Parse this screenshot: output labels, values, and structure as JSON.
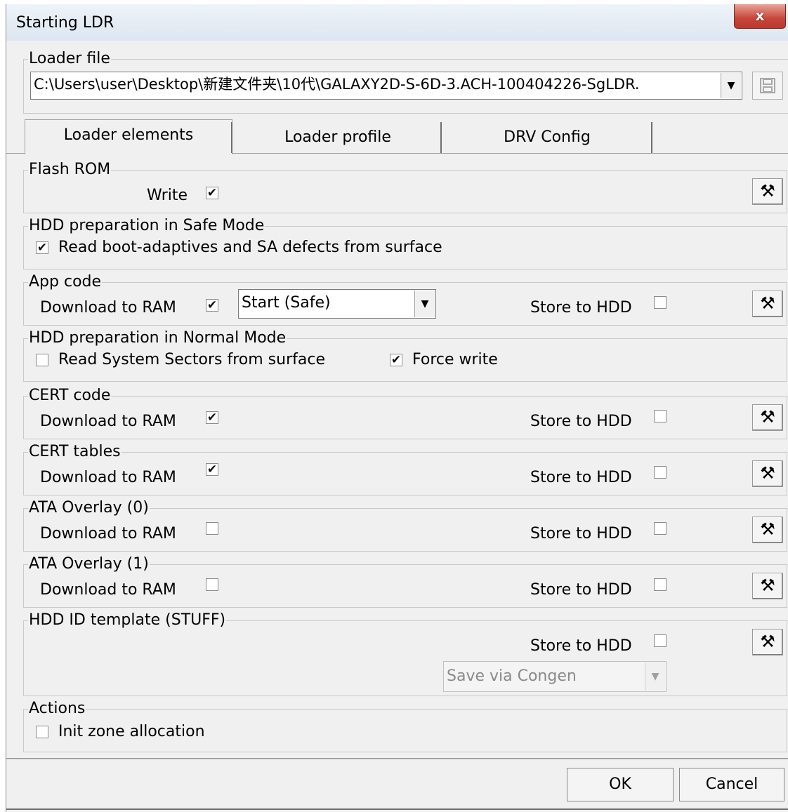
{
  "window": {
    "title": "Starting LDR",
    "close_label": "x"
  },
  "loader_file": {
    "legend": "Loader file",
    "path": "C:\\Users\\user\\Desktop\\新建文件夹\\10代\\GALAXY2D-S-6D-3.ACH-100404226-SgLDR."
  },
  "tabs": [
    {
      "label": "Loader elements",
      "active": true
    },
    {
      "label": "Loader profile",
      "active": false
    },
    {
      "label": "DRV Config",
      "active": false
    }
  ],
  "flash_rom": {
    "legend": "Flash ROM",
    "write_label": "Write",
    "write_checked": true
  },
  "hdd_safe": {
    "legend": "HDD preparation in Safe Mode",
    "read_label": "Read boot-adaptives and SA defects from surface",
    "read_checked": true
  },
  "app_code": {
    "legend": "App code",
    "download_label": "Download to RAM",
    "download_checked": true,
    "mode_value": "Start (Safe)",
    "store_label": "Store to HDD",
    "store_checked": false
  },
  "hdd_normal": {
    "legend": "HDD preparation in Normal Mode",
    "read_label": "Read System Sectors from surface",
    "read_checked": false,
    "force_label": "Force write",
    "force_checked": true
  },
  "cert_code": {
    "legend": "CERT code",
    "download_label": "Download to RAM",
    "download_checked": true,
    "store_label": "Store to HDD",
    "store_checked": false
  },
  "cert_tables": {
    "legend": "CERT tables",
    "download_label": "Download to RAM",
    "download_checked": true,
    "store_label": "Store to HDD",
    "store_checked": false
  },
  "ata0": {
    "legend": "ATA Overlay (0)",
    "download_label": "Download to RAM",
    "download_checked": false,
    "store_label": "Store to HDD",
    "store_checked": false
  },
  "ata1": {
    "legend": "ATA Overlay (1)",
    "download_label": "Download to RAM",
    "download_checked": false,
    "store_label": "Store to HDD",
    "store_checked": false
  },
  "hdd_id": {
    "legend": "HDD ID template (STUFF)",
    "store_label": "Store to HDD",
    "store_checked": false,
    "save_value": "Save via Congen"
  },
  "actions": {
    "legend": "Actions",
    "init_label": "Init zone allocation",
    "init_checked": false
  },
  "buttons": {
    "ok": "OK",
    "cancel": "Cancel"
  },
  "icons": {
    "tools": "tools-icon",
    "save": "floppy-disk-icon",
    "dropdown": "chevron-down-icon"
  }
}
